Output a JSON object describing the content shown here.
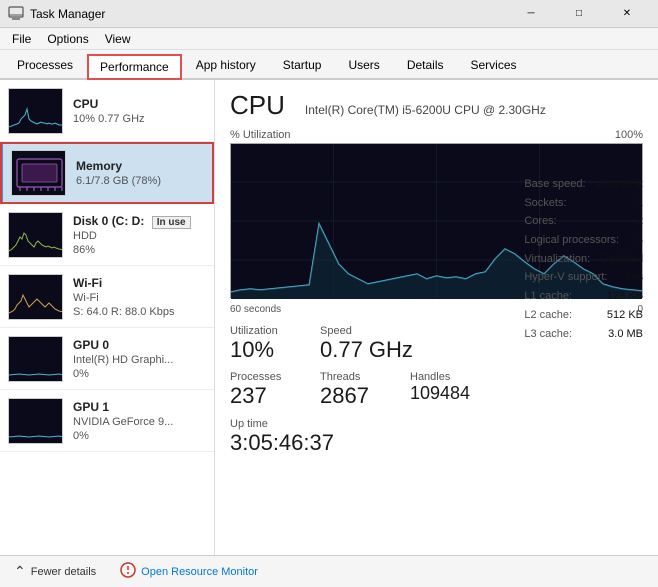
{
  "titleBar": {
    "icon": "⚙",
    "title": "Task Manager",
    "minBtn": "─",
    "maxBtn": "□",
    "closeBtn": "✕"
  },
  "menuBar": {
    "items": [
      "File",
      "Options",
      "View"
    ]
  },
  "tabBar": {
    "tabs": [
      "Processes",
      "Performance",
      "App history",
      "Startup",
      "Users",
      "Details",
      "Services"
    ],
    "activeTab": "Performance",
    "highlightedTab": "Performance"
  },
  "leftPanel": {
    "items": [
      {
        "id": "cpu",
        "name": "CPU",
        "detail": "10%  0.77 GHz",
        "selected": false
      },
      {
        "id": "memory",
        "name": "Memory",
        "detail": "6.1/7.8 GB (78%)",
        "selected": true,
        "outlined": true
      },
      {
        "id": "disk0",
        "name": "Disk 0 (C: D:",
        "detail": "HDD",
        "detail2": "86%",
        "inUse": true
      },
      {
        "id": "wifi",
        "name": "Wi-Fi",
        "detail": "Wi-Fi",
        "detail2": "S: 64.0  R: 88.0 Kbps"
      },
      {
        "id": "gpu0",
        "name": "GPU 0",
        "detail": "Intel(R) HD Graphi...",
        "detail2": "0%"
      },
      {
        "id": "gpu1",
        "name": "GPU 1",
        "detail": "NVIDIA GeForce 9...",
        "detail2": "0%"
      }
    ]
  },
  "rightPanel": {
    "title": "CPU",
    "subtitle": "Intel(R) Core(TM) i5-6200U CPU @ 2.30GHz",
    "chart": {
      "yLabel": "% Utilization",
      "yMax": "100%",
      "xLeft": "60 seconds",
      "xRight": "0"
    },
    "stats": {
      "utilization_label": "Utilization",
      "utilization_value": "10%",
      "speed_label": "Speed",
      "speed_value": "0.77 GHz",
      "processes_label": "Processes",
      "processes_value": "237",
      "threads_label": "Threads",
      "threads_value": "2867",
      "handles_label": "Handles",
      "handles_value": "109484",
      "uptime_label": "Up time",
      "uptime_value": "3:05:46:37"
    },
    "infoGrid": [
      {
        "key": "Base speed:",
        "val": "2.40 GHz"
      },
      {
        "key": "Sockets:",
        "val": "1"
      },
      {
        "key": "Cores:",
        "val": "2"
      },
      {
        "key": "Logical processors:",
        "val": "4"
      },
      {
        "key": "Virtualization:",
        "val": "Disabled"
      },
      {
        "key": "Hyper-V support:",
        "val": "Yes"
      },
      {
        "key": "L1 cache:",
        "val": "128 KB"
      },
      {
        "key": "L2 cache:",
        "val": "512 KB"
      },
      {
        "key": "L3 cache:",
        "val": "3.0 MB"
      }
    ]
  },
  "bottomBar": {
    "fewerDetailsLabel": "Fewer details",
    "openMonitorLabel": "Open Resource Monitor"
  }
}
